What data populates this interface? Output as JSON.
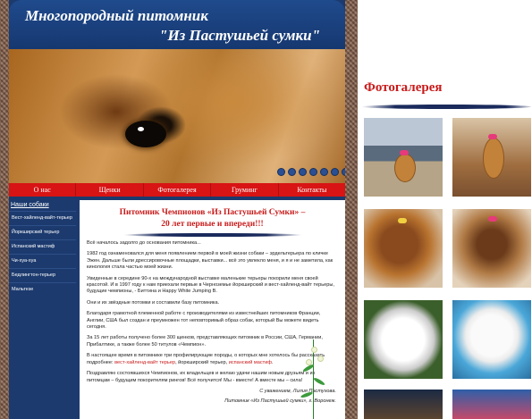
{
  "header": {
    "title_line1": "Многопородный питомник",
    "title_line2": "\"Из Пастушьей сумки\""
  },
  "nav": {
    "items": [
      "О нас",
      "Щенки",
      "Фотогалерея",
      "Груминг",
      "Контакты"
    ]
  },
  "sidebar": {
    "heading": "Наши собаки",
    "items": [
      "Вест-хайленд-вайт-терьер",
      "Йоркширский терьер",
      "Испанский мастиф",
      "Чи-хуа-хуа",
      "Бедлингтон-терьер",
      "Мальтезе"
    ]
  },
  "content": {
    "title": "Питомник Чемпионов «Из Пастушьей Сумки» –",
    "subtitle": "20 лет первые и впереди!!!",
    "p1": "Всё началось задолго до основания питомника...",
    "p2": "1982 год ознаменовался для меня появлением первой в моей жизни собаки – эрдельтерьера по кличке Эжен. Дальше были дрессировочные площадки, выставки... всё это увлекло меня, и я и не заметила, как кинология стала частью моей жизни.",
    "p3": "Увиденные в середине 90-х на международной выставке маленькие терьеры покорили меня своей красотой. И в 1997 году к нам приехали первые в Черноземье йоркширский и вест-хайленд-вайт терьеры, будущие чемпионы, - Биттина и Happy White Jumping B.",
    "p4": "Они и их звёздные потомки и составили базу питомника.",
    "p5": "Благодаря грамотной племенной работе с производителями из известнейших питомников Франции, Англии, США был создан и преумножен тот неповторимый образ собак, который Вы можете видеть сегодня.",
    "p6": "За 15 лет работы получено более 300 щенков, представляющих питомник в России, США, Германии, Прибалтике, а также более 50 титулов «Чемпион».",
    "p7_prefix": "В настоящее время в питомнике три профилирующие породы, о которых мне хотелось бы рассказать подробнее: ",
    "p7_link1": "вест-хайленд-вайт терьер",
    "p7_mid": ", йоркширский терьер, ",
    "p7_link2": "испанский мастиф",
    "p7_end": ".",
    "p8": "Поздравляю состоявшихся Чемпионов, их владельцев и желаю удачи нашим новым друзьям и их питомцам – будущим покорителям рингов! Всё получится! Мы - вместе! А вместе мы – сила!",
    "sign1": "С уважением, Лилия Пастухова.",
    "sign2": "Питомник «Из Пастушьей сумки», г. Воронеж."
  },
  "gallery": {
    "title": "Фотогалерея"
  },
  "colors": {
    "header_blue": "#1c3a6e",
    "nav_red": "#d81414",
    "accent_red": "#c81a1a"
  }
}
